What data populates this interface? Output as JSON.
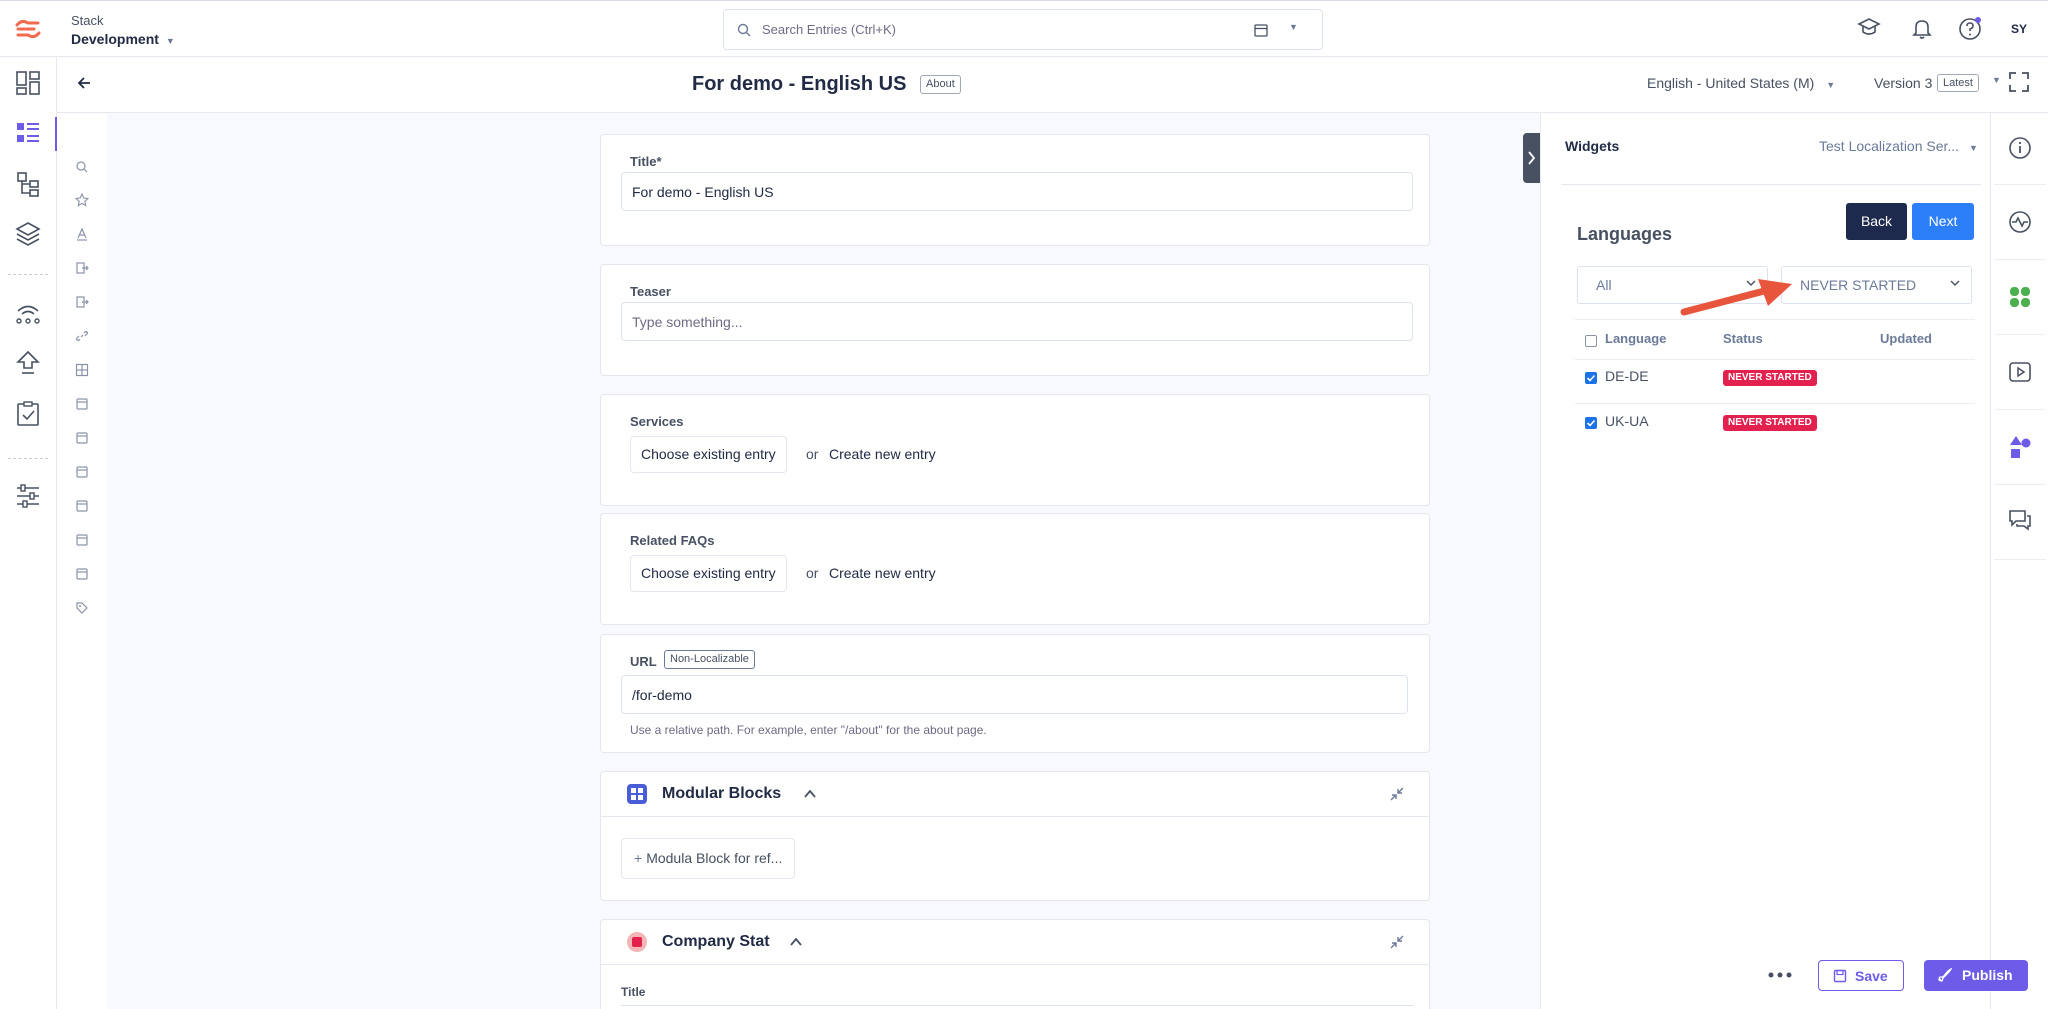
{
  "topbar": {
    "stack_label": "Stack",
    "stack_name": "Development",
    "search_placeholder": "Search Entries (Ctrl+K)",
    "avatar_initials": "SY"
  },
  "header": {
    "entry_title": "For demo - English US",
    "about_badge": "About",
    "locale": "English - United States (M)",
    "version": "Version 3",
    "latest_badge": "Latest"
  },
  "fields": {
    "title": {
      "label": "Title*",
      "value": "For demo - English US"
    },
    "teaser": {
      "label": "Teaser",
      "placeholder": "Type something..."
    },
    "services": {
      "label": "Services",
      "choose_label": "Choose existing entry",
      "or_label": "or",
      "create_label": "Create new entry"
    },
    "related_faqs": {
      "label": "Related FAQs",
      "choose_label": "Choose existing entry",
      "or_label": "or",
      "create_label": "Create new entry"
    },
    "url": {
      "label": "URL",
      "badge": "Non-Localizable",
      "value": "/for-demo",
      "help": "Use a relative path. For example, enter \"/about\" for the about page."
    },
    "modular_blocks": {
      "title": "Modular Blocks",
      "add_label": "Modula Block for ref..."
    },
    "company_stat": {
      "title": "Company Stat",
      "sub_label": "Title"
    }
  },
  "widgets": {
    "title": "Widgets",
    "selected_widget": "Test Localization Ser...",
    "languages_heading": "Languages",
    "back_label": "Back",
    "next_label": "Next",
    "filter_all": "All",
    "filter_status": "NEVER STARTED",
    "columns": [
      "Language",
      "Status",
      "Updated"
    ],
    "rows": [
      {
        "language": "DE-DE",
        "status": "NEVER STARTED",
        "checked": true
      },
      {
        "language": "UK-UA",
        "status": "NEVER STARTED",
        "checked": true
      }
    ]
  },
  "footer": {
    "save_label": "Save",
    "publish_label": "Publish"
  },
  "colors": {
    "accent": "#6c5ce7",
    "status_never_started": "#e3214f",
    "next_button": "#2d7ff9",
    "back_button": "#1d2a4d",
    "annotation_arrow": "#e8553d"
  },
  "icons": {
    "left_rail": [
      "dashboard-icon",
      "entries-icon",
      "content-models-icon",
      "assets-icon",
      "releases-icon",
      "deploy-icon",
      "tasks-icon",
      "settings-icon"
    ],
    "right_rail": [
      "info-icon",
      "activity-icon",
      "widget-app-icon",
      "preview-icon",
      "shapes-icon",
      "comments-icon"
    ]
  }
}
